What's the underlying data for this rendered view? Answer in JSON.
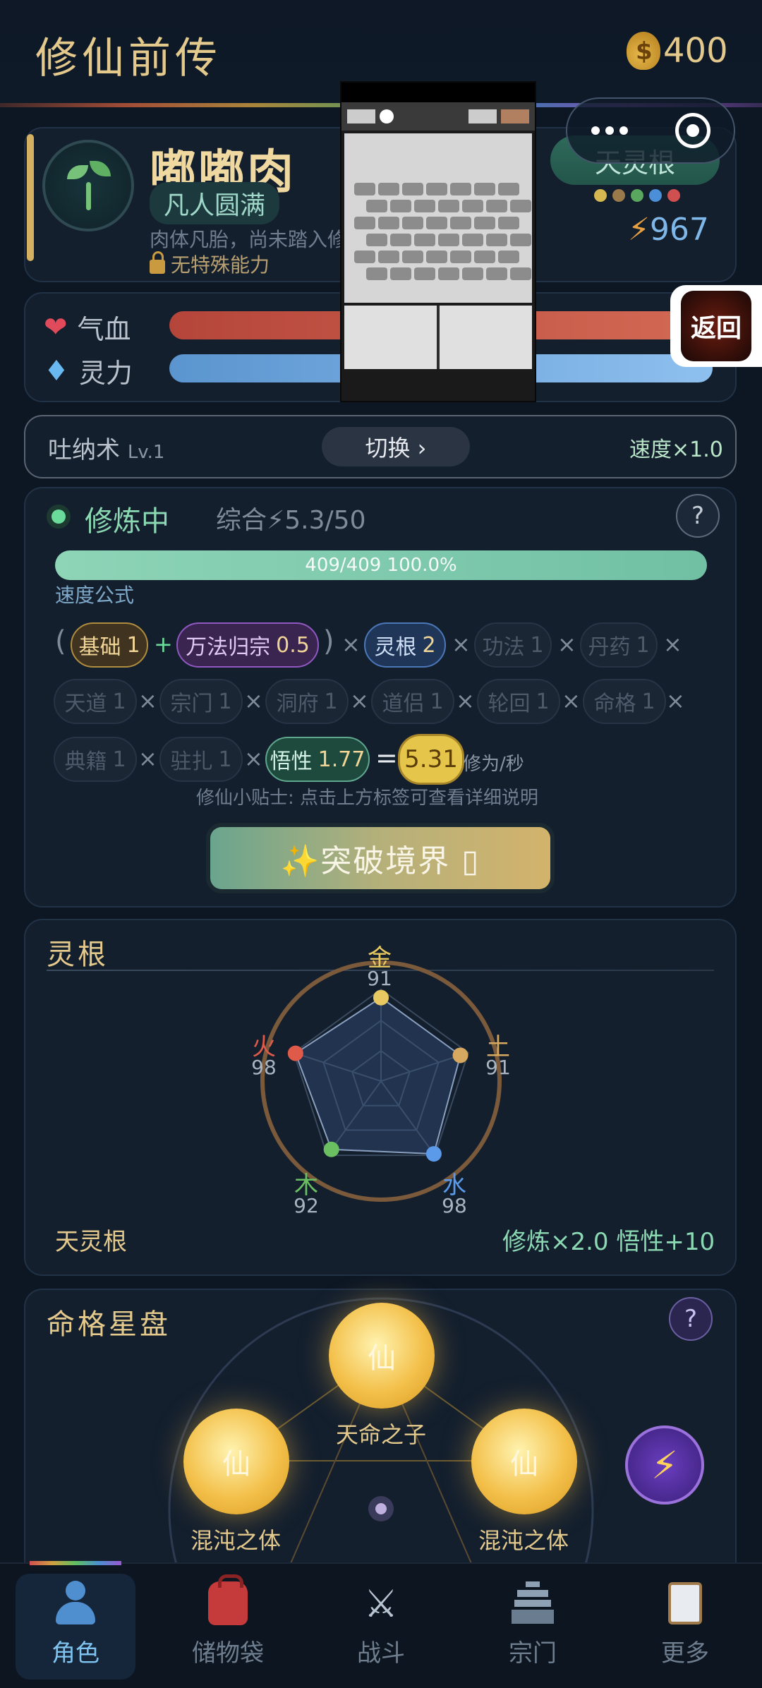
{
  "header": {
    "title": "修仙前传",
    "coins": "400"
  },
  "profile": {
    "name": "嘟嘟肉",
    "realm": "凡人圆满",
    "desc": "肉体凡胎，尚未踏入修",
    "ability": "无特殊能力",
    "root_badge": "天灵根",
    "energy": "967",
    "root_dot_colors": [
      "#d6b850",
      "#9a7a4a",
      "#5aa860",
      "#4a8fd8",
      "#d05050"
    ]
  },
  "stats": {
    "hp_label": "气血",
    "mp_label": "灵力"
  },
  "technique": {
    "name": "吐纳术",
    "level": "Lv.1",
    "switch_label": "切换 ›",
    "speed": "速度×1.0"
  },
  "cultivation": {
    "status": "修炼中",
    "total": "综合⚡5.3/50",
    "help": "?",
    "progress_text": "409/409  100.0%",
    "progress_fraction": 1.0,
    "formula_label": "速度公式",
    "chips": {
      "base": {
        "label": "基础",
        "value": "1"
      },
      "wanfa": {
        "label": "万法归宗",
        "value": "0.5"
      },
      "root": {
        "label": "灵根",
        "value": "2"
      },
      "gongfa": {
        "label": "功法",
        "value": "1"
      },
      "danyao": {
        "label": "丹药",
        "value": "1"
      },
      "tiandao": {
        "label": "天道",
        "value": "1"
      },
      "zongmen": {
        "label": "宗门",
        "value": "1"
      },
      "dongfu": {
        "label": "洞府",
        "value": "1"
      },
      "daolv": {
        "label": "道侣",
        "value": "1"
      },
      "lunhui": {
        "label": "轮回",
        "value": "1"
      },
      "mingge": {
        "label": "命格",
        "value": "1"
      },
      "dianji": {
        "label": "典籍",
        "value": "1"
      },
      "zhuzha": {
        "label": "驻扎",
        "value": "1"
      },
      "wuxing": {
        "label": "悟性",
        "value": "1.77"
      }
    },
    "result": "5.31",
    "unit": "修为/秒",
    "tip": "修仙小贴士: 点击上方标签可查看详细说明",
    "breakthrough": "✨突破境界 ▯"
  },
  "roots": {
    "title": "灵根",
    "elements": [
      {
        "name": "金",
        "value": "91",
        "color": "#e8c860"
      },
      {
        "name": "土",
        "value": "91",
        "color": "#d6a860"
      },
      {
        "name": "水",
        "value": "98",
        "color": "#5a9ae8"
      },
      {
        "name": "木",
        "value": "92",
        "color": "#6ac060"
      },
      {
        "name": "火",
        "value": "98",
        "color": "#e05a4a"
      }
    ],
    "name": "天灵根",
    "bonus": "修炼×2.0  悟性+10"
  },
  "destiny": {
    "title": "命格星盘",
    "help": "?",
    "orb_glyph": "仙",
    "orbs": [
      {
        "label": "天命之子"
      },
      {
        "label": "混沌之体"
      },
      {
        "label": "混沌之体"
      }
    ],
    "bolt": "⚡"
  },
  "overlay": {
    "back": "返回"
  },
  "nav": [
    {
      "label": "角色"
    },
    {
      "label": "储物袋"
    },
    {
      "label": "战斗"
    },
    {
      "label": "宗门"
    },
    {
      "label": "更多"
    }
  ]
}
